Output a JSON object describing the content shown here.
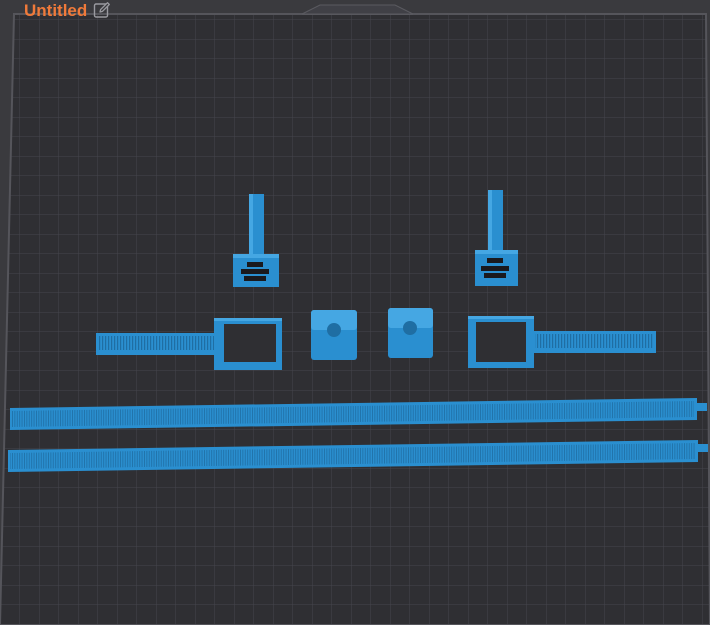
{
  "project": {
    "title": "Untitled"
  },
  "icons": {
    "rename": "pencil-edit-icon"
  },
  "colors": {
    "background": "#3a3a3e",
    "plate": "#2e2e32",
    "grid_line": "#4a4a50",
    "model": "#2a8fd0",
    "model_dark": "#1f6ea3",
    "model_light": "#45a7e3",
    "title_accent": "#f07a3a"
  }
}
